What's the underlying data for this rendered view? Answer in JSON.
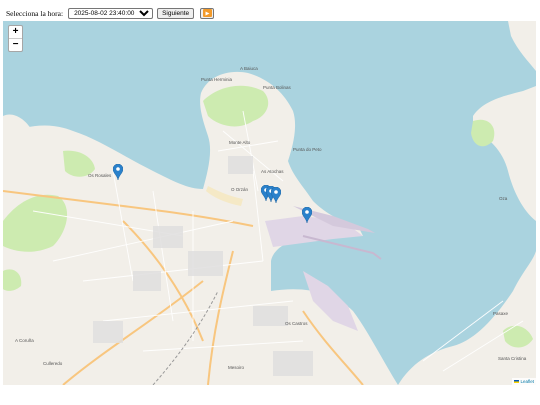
{
  "controls": {
    "hour_label": "Selecciona la hora:",
    "selected_hour": "2025-08-02 23:40:00",
    "next_button": "Siguiente"
  },
  "map": {
    "zoom_in": "+",
    "zoom_out": "−",
    "attribution": "Leaflet",
    "labels": {
      "a_baiuca": "A Baiuca",
      "punta_herminia": "Punta Herminia",
      "punta_bolinas": "Punta Bolinas",
      "monte_alto": "Monte Alto",
      "as_atochas": "As Atochas",
      "punta_do_peto": "Punta do Peto",
      "o_orzan": "O Orzán",
      "os_castros": "Os Castros",
      "mesoiro": "Mesoiro",
      "pasaxe": "Pasaxe",
      "oza": "Oza",
      "a_coruna": "A Coruña",
      "santa_cristina": "Santa Cristina",
      "culleredo": "Culleredo",
      "os_rosales": "Os Rosales"
    },
    "colors": {
      "water": "#aad3df",
      "land": "#f2efe9",
      "park": "#cdebb0",
      "port": "#e0d6e6",
      "marker": "#2a81cb"
    }
  }
}
